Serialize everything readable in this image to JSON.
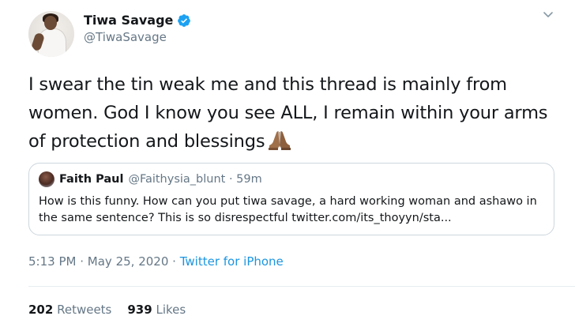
{
  "author": {
    "display_name": "Tiwa Savage",
    "handle": "@TiwaSavage",
    "verified": true,
    "avatar_icon": "profile-photo"
  },
  "tweet": {
    "text": "I swear the tin weak me and this thread is mainly from women. God I know you see ALL, I remain within your arms of protection and blessings",
    "emoji": "folded-hands"
  },
  "quoted_tweet": {
    "display_name": "Faith Paul",
    "handle": "@Faithysia_blunt",
    "time_ago": "59m",
    "separator": "·",
    "text": "How is this funny. How can you put tiwa savage, a hard working woman and ashawo in the same sentence? This is so disrespectful twitter.com/its_thoyyn/sta..."
  },
  "meta": {
    "time": "5:13 PM",
    "date": "May 25, 2020",
    "separator": "·",
    "source": "Twitter for iPhone"
  },
  "stats": {
    "retweets_count": "202",
    "retweets_label": "Retweets",
    "likes_count": "939",
    "likes_label": "Likes"
  },
  "colors": {
    "verified": "#1da1f2",
    "link": "#1b95e0",
    "secondary_text": "#657786",
    "border": "#ccd6dd"
  }
}
